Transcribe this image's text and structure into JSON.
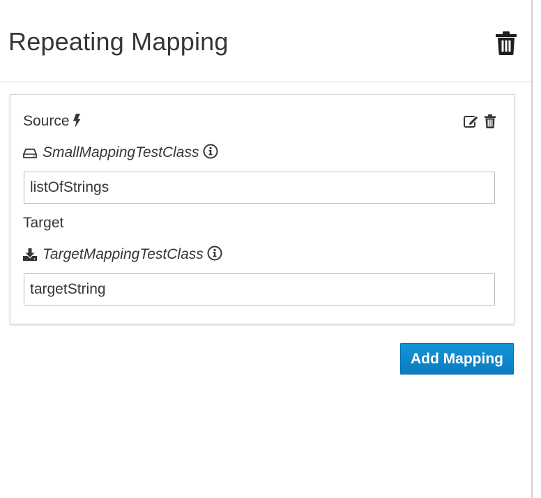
{
  "header": {
    "title": "Repeating Mapping",
    "delete_icon": "trash-icon"
  },
  "source": {
    "label": "Source",
    "label_icon": "bolt-icon",
    "edit_icon": "edit-icon",
    "delete_icon": "trash-icon",
    "document_icon": "hard-drive-icon",
    "document_class": "SmallMappingTestClass",
    "info_icon": "info-circle-icon",
    "field_value": "listOfStrings"
  },
  "target": {
    "label": "Target",
    "document_icon": "download-icon",
    "document_class": "TargetMappingTestClass",
    "info_icon": "info-circle-icon",
    "field_value": "targetString"
  },
  "footer": {
    "add_mapping_label": "Add Mapping"
  },
  "colors": {
    "primary_button": "#0a85c9",
    "text": "#363636",
    "border": "#bbbbbb"
  }
}
